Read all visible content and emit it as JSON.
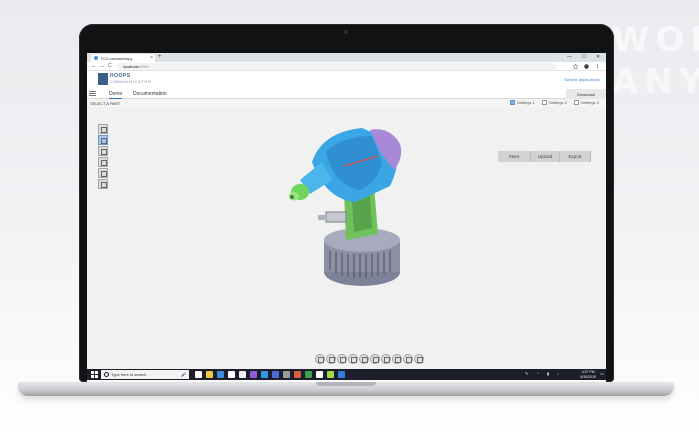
{
  "browser": {
    "tab_title": "TCG emulat/respy",
    "new_tab": "+",
    "tab_close": "×",
    "address": "localhost",
    "address_suffix": ":8080",
    "window_controls": [
      "—",
      "☐",
      "✕"
    ],
    "nav": [
      "←",
      "→",
      "C"
    ]
  },
  "app": {
    "logo_title": "HOOPS",
    "logo_sub": "COMMUNICATOR",
    "sample_link": "Sample applications",
    "menu": [
      "Demo",
      "Documentation"
    ],
    "download_label": "Download"
  },
  "subbar": {
    "select_label": "SELECT A PART",
    "settings": [
      {
        "label": "Settings 1",
        "checked": true
      },
      {
        "label": "Settings 2",
        "checked": false
      },
      {
        "label": "Settings 3",
        "checked": false
      }
    ]
  },
  "viewer": {
    "actions": [
      "Store",
      "Upload",
      "Export"
    ],
    "side_tools": [
      "home-icon",
      "select-icon",
      "cube-icon",
      "measure-icon",
      "cut-icon",
      "settings-icon"
    ],
    "active_side_tool": 1,
    "bottom_tools": [
      "orbit-icon",
      "pan-icon",
      "zoom-icon",
      "view-icon",
      "section-icon",
      "explode-icon",
      "camera-icon",
      "markup-icon",
      "settings-icon",
      "snapshot-icon"
    ],
    "model": {
      "accent_blue": "#3aa7e4",
      "purple": "#a889d8",
      "green": "#59c34a",
      "grey": "#8c90a3"
    }
  },
  "taskbar": {
    "search_placeholder": "Type here to search",
    "mic": "🎤",
    "time": "4:27 PM",
    "date": "5/30/2019",
    "icons": [
      {
        "name": "task-view-icon",
        "color": "#ffffff"
      },
      {
        "name": "file-explorer-icon",
        "color": "#f3c544"
      },
      {
        "name": "edge-icon",
        "color": "#3a8ddb"
      },
      {
        "name": "store-icon",
        "color": "#ffffff"
      },
      {
        "name": "chrome-icon",
        "color": "#f0f0f0"
      },
      {
        "name": "vs-icon",
        "color": "#8d5bd6"
      },
      {
        "name": "vscode-icon",
        "color": "#2e9ae0"
      },
      {
        "name": "app-icon",
        "color": "#4b6cd8"
      },
      {
        "name": "terminal-icon",
        "color": "#9b9b9b"
      },
      {
        "name": "app2-icon",
        "color": "#d95c3d"
      },
      {
        "name": "app3-icon",
        "color": "#3ba34a"
      },
      {
        "name": "app4-icon",
        "color": "#ffffff"
      },
      {
        "name": "app5-icon",
        "color": "#a1d94e"
      },
      {
        "name": "app6-icon",
        "color": "#2f7fe0"
      }
    ]
  }
}
